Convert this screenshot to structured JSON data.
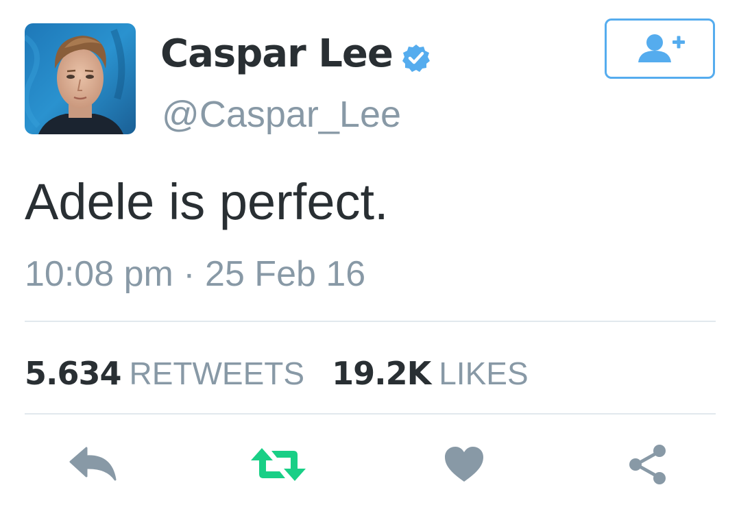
{
  "user": {
    "display_name": "Caspar Lee",
    "handle": "@Caspar_Lee",
    "verified": true,
    "avatar_icon": "profile-photo"
  },
  "follow_button": {
    "icon": "add-user-icon",
    "color": "#55acee"
  },
  "tweet": {
    "text": "Adele is perfect.",
    "timestamp": "10:08 pm · 25 Feb 16"
  },
  "stats": {
    "retweets_count": "5.634",
    "retweets_label": "RETWEETS",
    "likes_count": "19.2K",
    "likes_label": "LIKES"
  },
  "actions": [
    {
      "icon": "reply-icon",
      "color": "#8899a6"
    },
    {
      "icon": "retweet-icon",
      "color": "#19cf86"
    },
    {
      "icon": "heart-icon",
      "color": "#8899a6"
    },
    {
      "icon": "share-icon",
      "color": "#8899a6"
    }
  ],
  "colors": {
    "text_primary": "#292f33",
    "text_secondary": "#8899a6",
    "accent": "#55acee",
    "retweeted": "#19cf86",
    "divider": "#e1e8ed"
  }
}
